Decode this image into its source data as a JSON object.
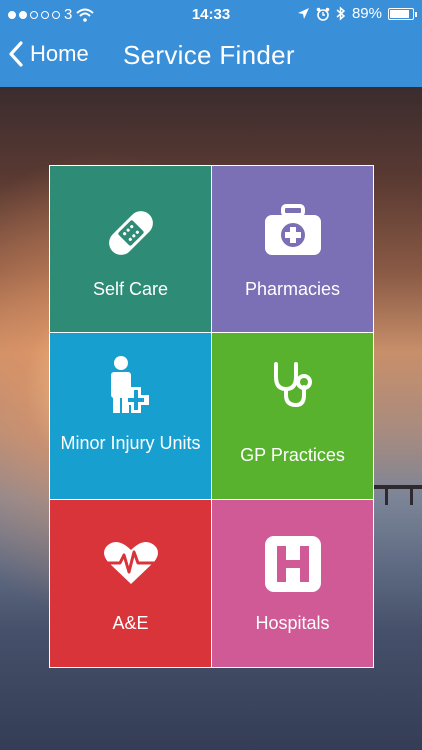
{
  "status_bar": {
    "carrier": "3",
    "time": "14:33",
    "battery": "89%",
    "battery_level": 0.89
  },
  "nav": {
    "back_label": "Home",
    "title": "Service Finder"
  },
  "tiles": [
    {
      "label": "Self Care",
      "color": "#2e8b75",
      "icon": "bandage-icon"
    },
    {
      "label": "Pharmacies",
      "color": "#7b6fb5",
      "icon": "first-aid-kit-icon"
    },
    {
      "label": "Minor Injury Units",
      "color": "#179fd0",
      "icon": "injured-person-icon"
    },
    {
      "label": "GP Practices",
      "color": "#58b22e",
      "icon": "stethoscope-icon"
    },
    {
      "label": "A&E",
      "color": "#d9343a",
      "icon": "heartbeat-icon"
    },
    {
      "label": "Hospitals",
      "color": "#cf5a95",
      "icon": "hospital-sign-icon"
    }
  ],
  "colors": {
    "nav_bar": "#3a8fd9",
    "text": "#ffffff"
  }
}
